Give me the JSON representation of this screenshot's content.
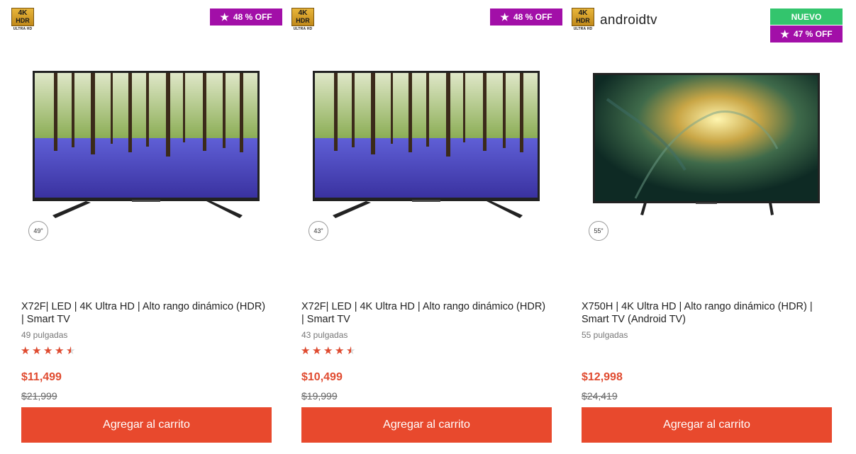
{
  "products": [
    {
      "logo": {
        "top": "4K",
        "middle": "HDR",
        "bottom": "ULTRA HD"
      },
      "brand_text": "",
      "badge_new": "",
      "discount": "48 %  OFF",
      "screen": "forest",
      "size_chip": "49\"",
      "title": "X72F| LED | 4K Ultra HD | Alto rango dinámico (HDR) | Smart TV",
      "subtitle": "49 pulgadas",
      "rating": 4.5,
      "price": "$11,499",
      "old_price": "$21,999",
      "cart_label": "Agregar al carrito"
    },
    {
      "logo": {
        "top": "4K",
        "middle": "HDR",
        "bottom": "ULTRA HD"
      },
      "brand_text": "",
      "badge_new": "",
      "discount": "48 %  OFF",
      "screen": "forest",
      "size_chip": "43\"",
      "title": "X72F| LED | 4K Ultra HD | Alto rango dinámico (HDR) | Smart TV",
      "subtitle": "43 pulgadas",
      "rating": 4.5,
      "price": "$10,499",
      "old_price": "$19,999",
      "cart_label": "Agregar al carrito"
    },
    {
      "logo": {
        "top": "4K",
        "middle": "HDR",
        "bottom": "ULTRA HD"
      },
      "brand_text": "androidtv",
      "badge_new": "NUEVO",
      "discount": "47 %  OFF",
      "screen": "abstract",
      "size_chip": "55\"",
      "title": "X750H | 4K Ultra HD | Alto rango dinámico (HDR) | Smart TV (Android TV)",
      "subtitle": "55 pulgadas",
      "rating": null,
      "price": "$12,998",
      "old_price": "$24,419",
      "cart_label": "Agregar al carrito"
    }
  ],
  "colors": {
    "accent": "#e8492d",
    "price": "#e04a2f",
    "discount_badge": "#a20fa8",
    "new_badge": "#33c56d"
  }
}
